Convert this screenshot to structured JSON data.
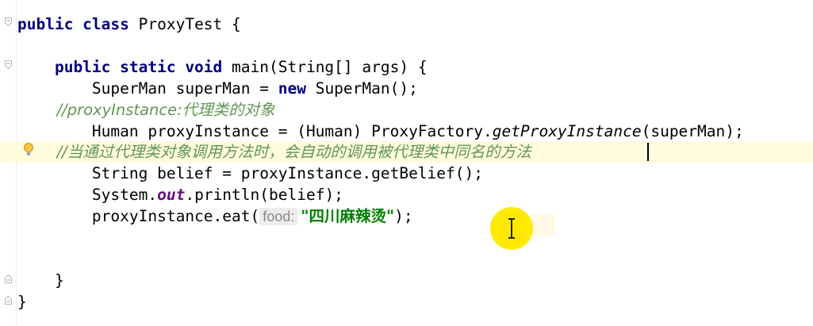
{
  "editor": {
    "lines": [
      {
        "id": "l1",
        "tokens": [
          {
            "t": "public class ",
            "c": "kw"
          },
          {
            "t": "ProxyTest {",
            "c": ""
          }
        ]
      },
      {
        "id": "l2",
        "tokens": []
      },
      {
        "id": "l3",
        "tokens": [
          {
            "t": "    public static void ",
            "c": "kw"
          },
          {
            "t": "main(String[] args) {",
            "c": ""
          }
        ]
      },
      {
        "id": "l4",
        "tokens": [
          {
            "t": "        SuperMan superMan = ",
            "c": ""
          },
          {
            "t": "new ",
            "c": "kw"
          },
          {
            "t": "SuperMan();",
            "c": ""
          }
        ]
      },
      {
        "id": "l5",
        "tokens": [
          {
            "t": "        //proxyInstance:",
            "c": "cm-zh"
          },
          {
            "t": "代理类的对象",
            "c": "cm-zh"
          }
        ]
      },
      {
        "id": "l6",
        "tokens": [
          {
            "t": "        Human proxyInstance = (Human) ProxyFactory.",
            "c": ""
          },
          {
            "t": "getProxyInstance",
            "c": "it"
          },
          {
            "t": "(superMan);",
            "c": ""
          }
        ]
      },
      {
        "id": "l7",
        "tokens": [
          {
            "t": "        //当通过代理类对象调用方法时，会自动的调用被代理类中同名的方法",
            "c": "cm-zh"
          }
        ]
      },
      {
        "id": "l8",
        "tokens": [
          {
            "t": "        String belief = proxyInstance.getBelief();",
            "c": ""
          }
        ]
      },
      {
        "id": "l9",
        "tokens": [
          {
            "t": "        System.",
            "c": ""
          },
          {
            "t": "out",
            "c": "static-field"
          },
          {
            "t": ".println(belief);",
            "c": ""
          }
        ]
      },
      {
        "id": "l10",
        "tokens": [
          {
            "t": "        proxyInstance.eat(",
            "c": ""
          },
          {
            "t": "food:",
            "c": "hint"
          },
          {
            "t": "\"四川麻辣烫\"",
            "c": "str"
          },
          {
            "t": ");",
            "c": ""
          }
        ]
      },
      {
        "id": "l11",
        "tokens": []
      },
      {
        "id": "l12",
        "tokens": []
      },
      {
        "id": "l13",
        "tokens": [
          {
            "t": "    }",
            "c": ""
          }
        ]
      },
      {
        "id": "l14",
        "tokens": [
          {
            "t": "}",
            "c": ""
          }
        ]
      }
    ]
  },
  "icons": {
    "bulb": "lightbulb-intention-icon",
    "fold": "fold-marker-icon",
    "cursor": "ibeam-mouse-cursor-icon"
  },
  "colors": {
    "keyword": "#000080",
    "comment": "#629755",
    "string": "#008000",
    "static_field": "#660e7a",
    "caret_row": "#fffbdd",
    "mouse_highlight": "#ffe600"
  }
}
